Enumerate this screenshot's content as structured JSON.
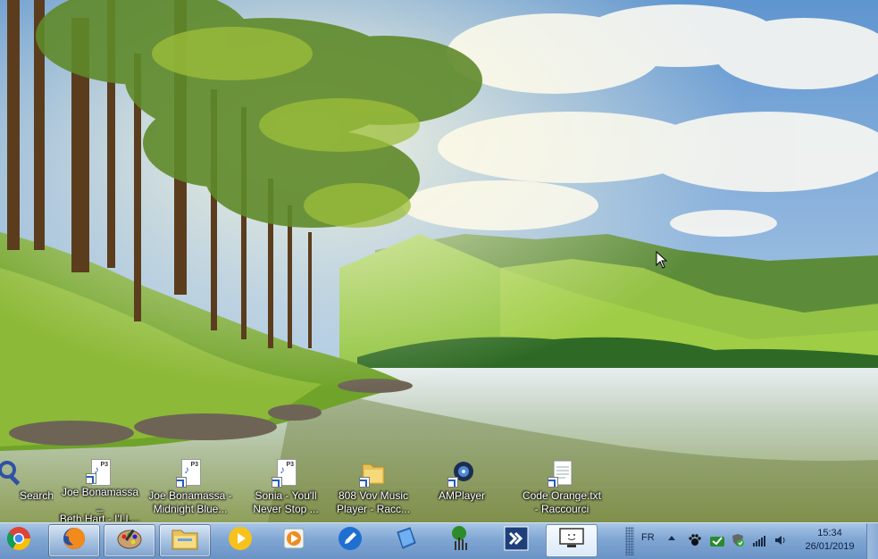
{
  "desktop": {
    "icons": [
      {
        "name": "search",
        "label": "Search",
        "icon": "magnifier-icon"
      },
      {
        "name": "joe-bonamassa-beth-hart",
        "label": "Joe Bonamassa _\nBeth Hart - I'LL...",
        "icon": "mp3-shortcut-icon"
      },
      {
        "name": "joe-bonamassa-midnight-blue",
        "label": "Joe Bonamassa -\nMidnight Blue...",
        "icon": "mp3-shortcut-icon"
      },
      {
        "name": "sonia-youll-never-stop",
        "label": "Sonia - You'll\nNever Stop ...",
        "icon": "mp3-shortcut-icon"
      },
      {
        "name": "808-vov-music-player",
        "label": "808 Vov Music\nPlayer - Racc...",
        "icon": "folder-shortcut-icon"
      },
      {
        "name": "amplayer",
        "label": "AMPlayer",
        "icon": "amplayer-icon"
      },
      {
        "name": "code-orange",
        "label": "Code Orange.txt\n- Raccourci",
        "icon": "text-file-shortcut-icon"
      }
    ]
  },
  "taskbar": {
    "pinned": [
      {
        "name": "chrome",
        "icon": "chrome-icon",
        "state": "pinned"
      },
      {
        "name": "firefox",
        "icon": "firefox-icon",
        "state": "open"
      },
      {
        "name": "paint",
        "icon": "paint-palette-icon",
        "state": "open"
      },
      {
        "name": "explorer",
        "icon": "file-explorer-icon",
        "state": "open"
      },
      {
        "name": "media-player-yellow",
        "icon": "yellow-play-icon",
        "state": "pinned"
      },
      {
        "name": "video-player",
        "icon": "video-player-icon",
        "state": "pinned"
      },
      {
        "name": "pencil-app",
        "icon": "blue-pencil-icon",
        "state": "pinned"
      },
      {
        "name": "book-app",
        "icon": "book-icon",
        "state": "pinned"
      },
      {
        "name": "equalizer-app",
        "icon": "equalizer-icon",
        "state": "pinned"
      },
      {
        "name": "remote-app",
        "icon": "double-arrow-icon",
        "state": "pinned"
      },
      {
        "name": "monitor-app",
        "icon": "monitor-icon",
        "state": "active"
      }
    ],
    "tray": {
      "language": "FR",
      "icons": [
        "paw-icon",
        "green-check-icon",
        "shield-check-icon",
        "signal-bars-icon",
        "speaker-icon"
      ]
    },
    "clock": {
      "time": "15:34",
      "date": "26/01/2019"
    }
  },
  "colors": {
    "taskbar_top": "#a9c6e6",
    "taskbar_bottom": "#6a93c6",
    "sky": "#6aa0d6",
    "hills": "#7fbf3a",
    "water": "#c9d8c4"
  }
}
